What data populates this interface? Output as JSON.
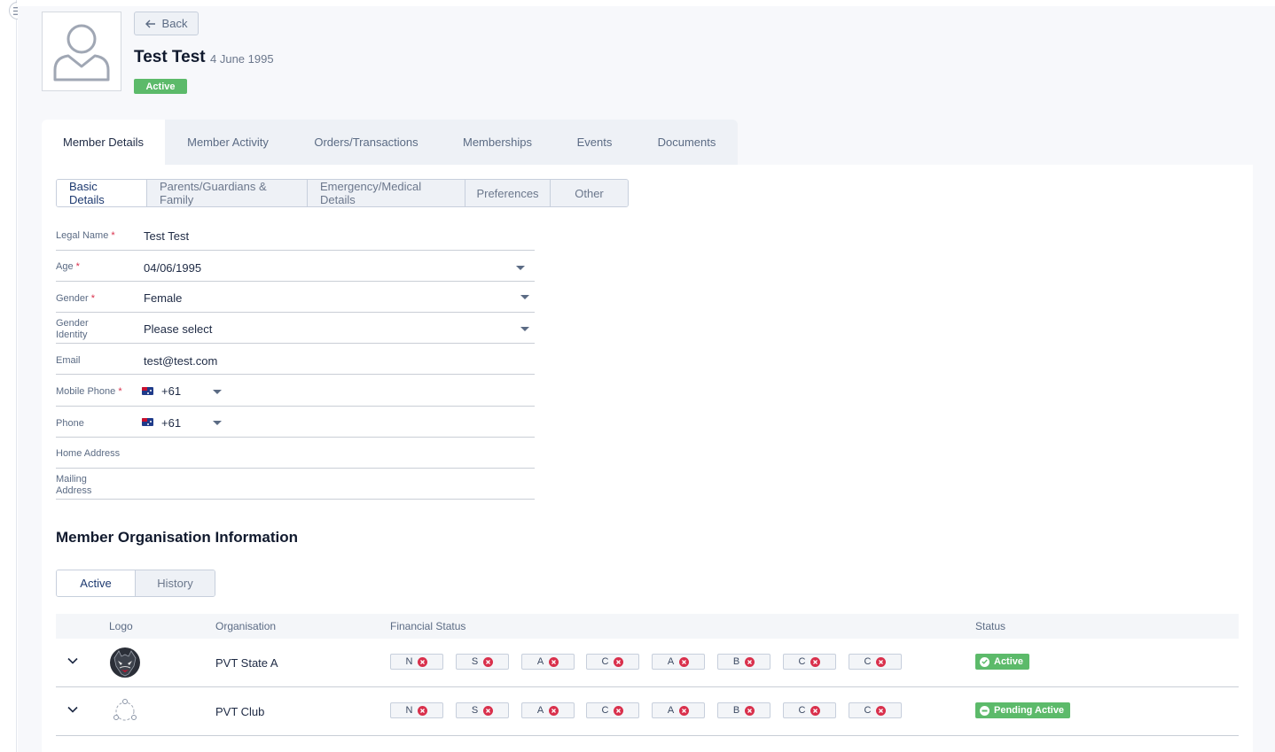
{
  "header": {
    "back_label": "Back",
    "name": "Test Test",
    "dob": "4 June 1995",
    "status": "Active"
  },
  "tabs": [
    {
      "label": "Member Details"
    },
    {
      "label": "Member Activity"
    },
    {
      "label": "Orders/Transactions"
    },
    {
      "label": "Memberships"
    },
    {
      "label": "Events"
    },
    {
      "label": "Documents"
    }
  ],
  "subtabs": [
    {
      "label": "Basic Details"
    },
    {
      "label": "Parents/Guardians & Family"
    },
    {
      "label": "Emergency/Medical Details"
    },
    {
      "label": "Preferences"
    },
    {
      "label": "Other"
    }
  ],
  "fields": {
    "legal_name": {
      "label": "Legal Name",
      "value": "Test Test"
    },
    "age": {
      "label": "Age",
      "value": "04/06/1995"
    },
    "gender": {
      "label": "Gender",
      "value": "Female"
    },
    "gender_identity": {
      "label": "Gender Identity",
      "value": "Please select"
    },
    "email": {
      "label": "Email",
      "value": "test@test.com"
    },
    "mobile_phone": {
      "label": "Mobile Phone",
      "code": "+61"
    },
    "phone": {
      "label": "Phone",
      "code": "+61"
    },
    "home_address": {
      "label": "Home Address",
      "value": ""
    },
    "mailing_address": {
      "label": "Mailing Address",
      "value": ""
    }
  },
  "org_section": {
    "title": "Member Organisation Information",
    "tabs": [
      {
        "label": "Active"
      },
      {
        "label": "History"
      }
    ],
    "columns": {
      "logo": "Logo",
      "organisation": "Organisation",
      "financial": "Financial Status",
      "status": "Status"
    },
    "rows": [
      {
        "organisation": "PVT State A",
        "financial": [
          "N",
          "S",
          "A",
          "C",
          "A",
          "B",
          "C",
          "C"
        ],
        "status": "Active"
      },
      {
        "organisation": "PVT Club",
        "financial": [
          "N",
          "S",
          "A",
          "C",
          "A",
          "B",
          "C",
          "C"
        ],
        "status": "Pending Active"
      }
    ]
  },
  "colors": {
    "accent": "#1e3a70",
    "success": "#5cba6a",
    "danger": "#d9304c"
  }
}
